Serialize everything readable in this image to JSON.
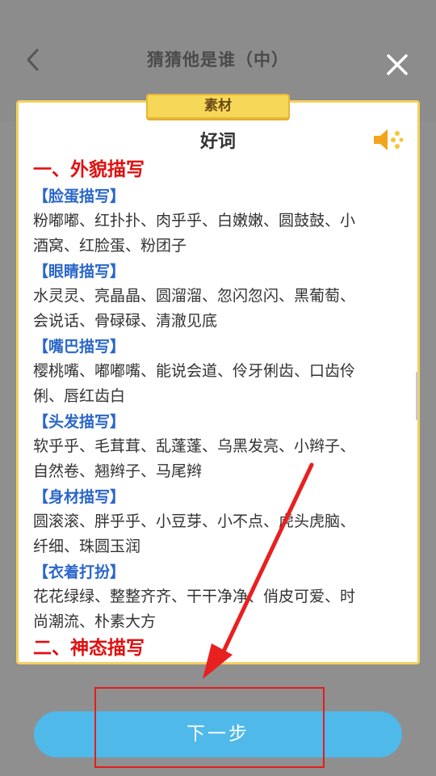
{
  "header": {
    "title": "猜猜他是谁（中）"
  },
  "card": {
    "ribbon": "素材",
    "title": "好词",
    "sections": [
      {
        "heading": "一、外貌描写"
      },
      {
        "heading": "二、神态描写"
      }
    ],
    "groups": [
      {
        "label": "【脸蛋描写】",
        "lines": [
          "粉嘟嘟、红扑扑、肉乎乎、白嫩嫩、圆鼓鼓、小",
          "酒窝、红脸蛋、粉团子"
        ]
      },
      {
        "label": "【眼睛描写】",
        "lines": [
          "水灵灵、亮晶晶、圆溜溜、忽闪忽闪、黑葡萄、",
          "会说话、骨碌碌、清澈见底"
        ]
      },
      {
        "label": "【嘴巴描写】",
        "lines": [
          "樱桃嘴、嘟嘟嘴、能说会道、伶牙俐齿、口齿伶",
          "俐、唇红齿白"
        ]
      },
      {
        "label": "【头发描写】",
        "lines": [
          "软乎乎、毛茸茸、乱蓬蓬、乌黑发亮、小辫子、",
          "自然卷、翘辫子、马尾辫"
        ]
      },
      {
        "label": "【身材描写】",
        "lines": [
          "圆滚滚、胖乎乎、小豆芽、小不点、虎头虎脑、",
          "纤细、珠圆玉润"
        ]
      },
      {
        "label": "【衣着打扮】",
        "lines": [
          "花花绿绿、整整齐齐、干干净净、俏皮可爱、时",
          "尚潮流、朴素大方"
        ]
      }
    ]
  },
  "footer": {
    "next_label": "下一步"
  },
  "colors": {
    "accent_red": "#e20f0f",
    "accent_blue": "#2b67c9",
    "button_blue": "#4fb9e9",
    "ribbon_yellow": "#f7d757"
  },
  "icons": {
    "back": "chevron-left-icon",
    "close": "close-icon",
    "audio": "speaker-icon"
  }
}
